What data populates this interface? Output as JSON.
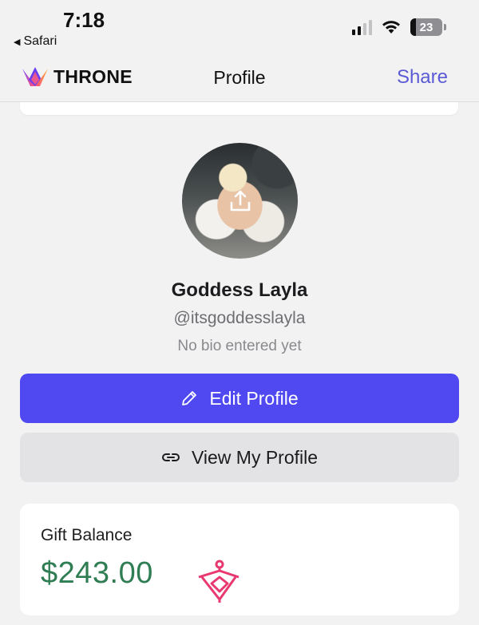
{
  "status_bar": {
    "time": "7:18",
    "back_app": "Safari",
    "battery": "23"
  },
  "header": {
    "brand": "THRONE",
    "title": "Profile",
    "share": "Share"
  },
  "profile": {
    "display_name": "Goddess Layla",
    "username": "@itsgoddesslayla",
    "bio": "No bio entered yet"
  },
  "actions": {
    "edit_label": "Edit Profile",
    "view_label": "View My Profile"
  },
  "balance": {
    "label": "Gift Balance",
    "amount": "$243.00"
  },
  "colors": {
    "accent": "#5049f1",
    "share_link": "#5b5bd6",
    "balance_green": "#2f7d53",
    "gift_icon": "#e8386f"
  },
  "icons": [
    "chevron-back-icon",
    "signal-icon",
    "wifi-icon",
    "battery-icon",
    "throne-logo-icon",
    "upload-icon",
    "pencil-icon",
    "link-icon",
    "gift-bow-icon"
  ]
}
